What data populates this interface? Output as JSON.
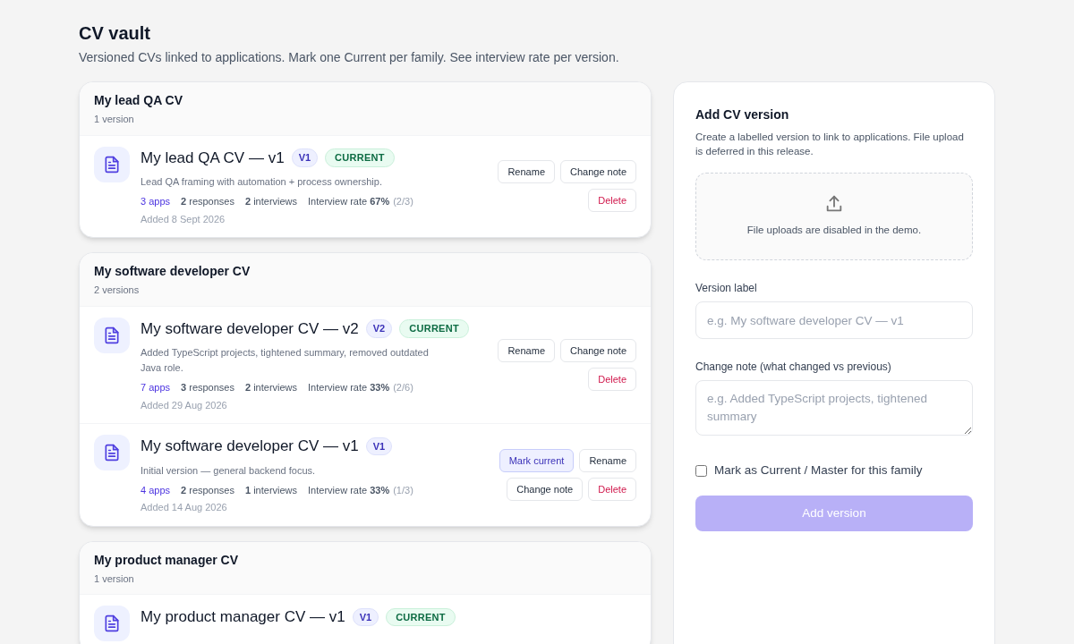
{
  "page": {
    "title": "CV vault",
    "subtitle": "Versioned CVs linked to applications. Mark one Current per family. See interview rate per version."
  },
  "families": [
    {
      "name": "My lead QA CV",
      "count": "1 version",
      "versions": [
        {
          "title": "My lead QA CV — v1",
          "version": "V1",
          "current_badge": "CURRENT",
          "note": "Lead QA framing with automation + process ownership.",
          "apps": "3 apps",
          "responses": "**2** responses",
          "interviews": "**2** interviews",
          "rate": "Interview rate **67%**",
          "rate_detail": "(2/3)",
          "added": "Added 8 Sept 2026",
          "buttons": [
            {
              "label": "Rename",
              "kind": "default"
            },
            {
              "label": "Change note",
              "kind": "default"
            },
            {
              "label": "Delete",
              "kind": "danger"
            }
          ]
        }
      ]
    },
    {
      "name": "My software developer CV",
      "count": "2 versions",
      "versions": [
        {
          "title": "My software developer CV — v2",
          "version": "V2",
          "current_badge": "CURRENT",
          "note": "Added TypeScript projects, tightened summary, removed outdated Java role.",
          "apps": "7 apps",
          "responses": "**3** responses",
          "interviews": "**2** interviews",
          "rate": "Interview rate **33%**",
          "rate_detail": "(2/6)",
          "added": "Added 29 Aug 2026",
          "buttons": [
            {
              "label": "Rename",
              "kind": "default"
            },
            {
              "label": "Change note",
              "kind": "default"
            },
            {
              "label": "Delete",
              "kind": "danger"
            }
          ]
        },
        {
          "title": "My software developer CV — v1",
          "version": "V1",
          "note": "Initial version — general backend focus.",
          "apps": "4 apps",
          "responses": "**2** responses",
          "interviews": "**1** interviews",
          "rate": "Interview rate **33%**",
          "rate_detail": "(1/3)",
          "added": "Added 14 Aug 2026",
          "buttons": [
            {
              "label": "Mark current",
              "kind": "primary"
            },
            {
              "label": "Rename",
              "kind": "default"
            },
            {
              "label": "Change note",
              "kind": "default"
            },
            {
              "label": "Delete",
              "kind": "danger"
            }
          ]
        }
      ]
    },
    {
      "name": "My product manager CV",
      "count": "1 version",
      "versions": [
        {
          "title": "My product manager CV — v1",
          "version": "V1",
          "current_badge": "CURRENT"
        }
      ]
    }
  ],
  "form": {
    "title": "Add CV version",
    "description": "Create a labelled version to link to applications. File upload is deferred in this release.",
    "upload_note": "File uploads are disabled in the demo.",
    "label_field": {
      "label": "Version label",
      "placeholder": "e.g. My software developer CV — v1"
    },
    "note_field": {
      "label": "Change note (what changed vs previous)",
      "placeholder": "e.g. Added TypeScript projects, tightened summary"
    },
    "current_checkbox": {
      "label": "Mark as Current / Master for this family",
      "checked": false
    },
    "submit": {
      "label": "Add version",
      "disabled": true
    }
  }
}
